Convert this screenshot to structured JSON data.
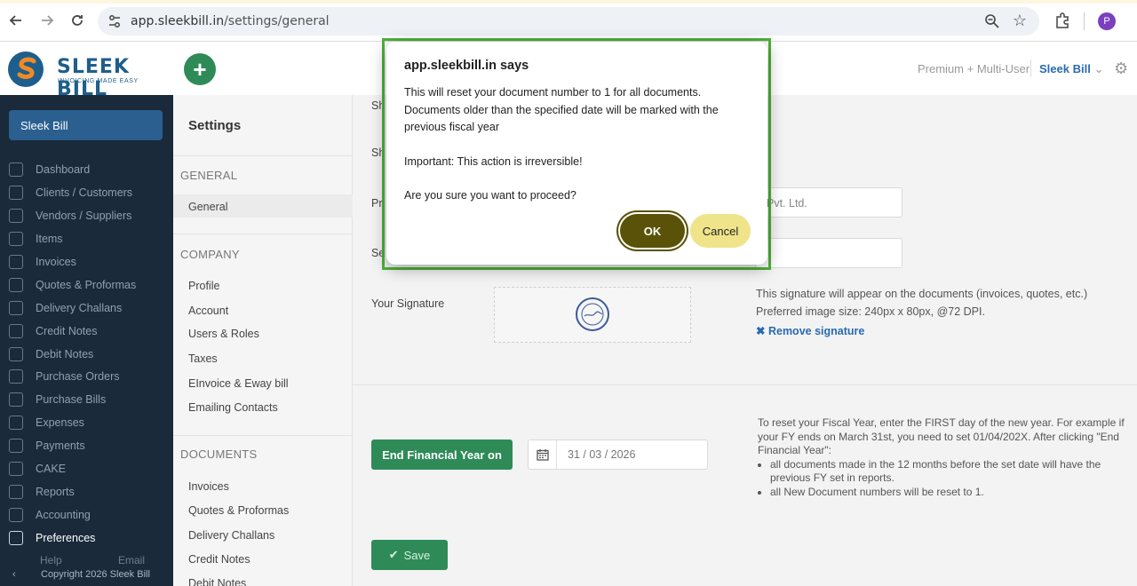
{
  "browser": {
    "url_host": "app.sleekbill.in",
    "url_path": "/settings/general",
    "avatar_letter": "P"
  },
  "header": {
    "brand": "SLEEK BILL",
    "tagline": "INVOICING MADE EASY",
    "plan": "Premium + Multi-User",
    "company": "Sleek Bill"
  },
  "sidebar": {
    "company": "Sleek Bill",
    "items": [
      {
        "label": "Dashboard"
      },
      {
        "label": "Clients / Customers"
      },
      {
        "label": "Vendors / Suppliers"
      },
      {
        "label": "Items"
      },
      {
        "label": "Invoices"
      },
      {
        "label": "Quotes & Proformas"
      },
      {
        "label": "Delivery Challans"
      },
      {
        "label": "Credit Notes"
      },
      {
        "label": "Debit Notes"
      },
      {
        "label": "Purchase Orders"
      },
      {
        "label": "Purchase Bills"
      },
      {
        "label": "Expenses"
      },
      {
        "label": "Payments"
      },
      {
        "label": "CAKE"
      },
      {
        "label": "Reports"
      },
      {
        "label": "Accounting"
      },
      {
        "label": "Preferences"
      }
    ],
    "help": "Help",
    "email": "Email",
    "copyright": "Copyright 2026 Sleek Bill"
  },
  "settings_nav": {
    "title": "Settings",
    "general_section": "GENERAL",
    "general_items": [
      "General"
    ],
    "company_section": "COMPANY",
    "company_items": [
      "Profile",
      "Account",
      "Users & Roles",
      "Taxes",
      "EInvoice & Eway bill",
      "Emailing Contacts"
    ],
    "documents_section": "DOCUMENTS",
    "documents_items": [
      "Invoices",
      "Quotes & Proformas",
      "Delivery Challans",
      "Credit Notes",
      "Debit Notes"
    ]
  },
  "main": {
    "partial_labels": [
      "Sh",
      "Sh",
      "Pri",
      "Se"
    ],
    "company_name_value": "Pvt. Ltd.",
    "signature_label": "Your Signature",
    "signature_note_1": "This signature will appear on the documents (invoices, quotes, etc.)",
    "signature_note_2": "Preferred image size: 240px x 80px, @72 DPI.",
    "remove_signature": "Remove signature",
    "fy_button": "End Financial Year on",
    "fy_date": "31 / 03 / 2026",
    "fy_help_intro": "To reset your Fiscal Year, enter the FIRST day of the new year. For example if your FY ends on March 31st, you need to set 01/04/202X. After clicking \"End Financial Year\":",
    "fy_help_bullets": [
      "all documents made in the 12 months before the set date will have the previous FY set in reports.",
      "all New Document numbers will be reset to 1."
    ],
    "save_label": "Save"
  },
  "dialog": {
    "title": "app.sleekbill.in says",
    "line1": "This will reset your document number to 1 for all documents. Documents older than the specified date will be marked with the previous fiscal year",
    "line2": "Important: This action is irreversible!",
    "line3": "Are you sure you want to proceed?",
    "ok": "OK",
    "cancel": "Cancel"
  }
}
